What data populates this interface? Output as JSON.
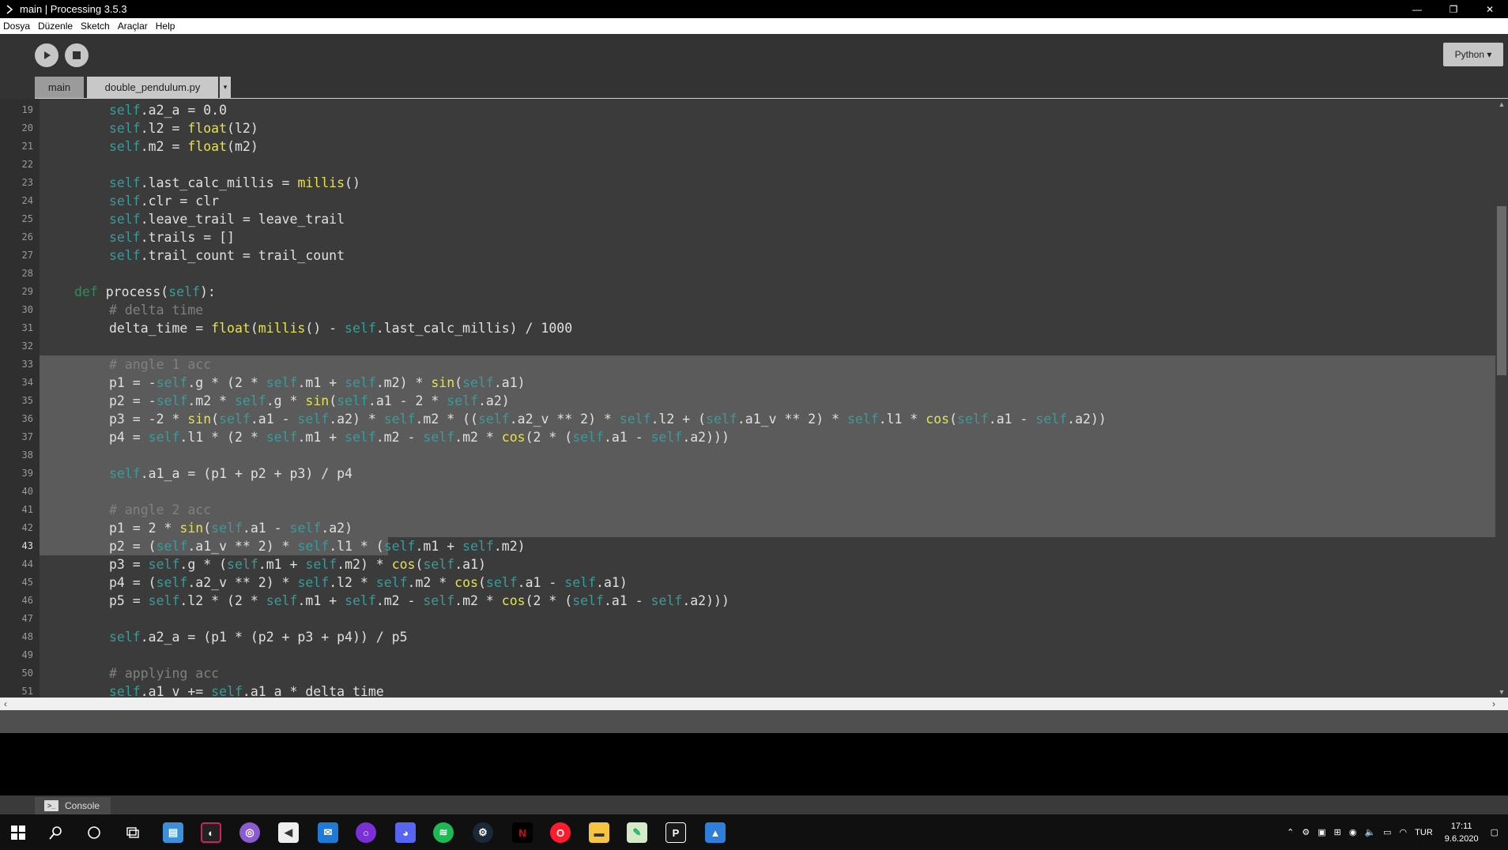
{
  "window": {
    "title": "main | Processing 3.5.3",
    "minimize": "—",
    "maximize": "❐",
    "close": "✕"
  },
  "menu": [
    "Dosya",
    "Düzenle",
    "Sketch",
    "Araçlar",
    "Help"
  ],
  "toolbar": {
    "run_icon": "play-icon",
    "stop_icon": "stop-icon",
    "mode": "Python ▾"
  },
  "tabs": [
    {
      "label": "main"
    },
    {
      "label": "double_pendulum.py"
    },
    {
      "label": "▾"
    }
  ],
  "editor": {
    "selection_start_line": 33,
    "selection_end_line": 43,
    "current_line": 43,
    "lines": [
      {
        "n": "19",
        "tokens": [
          [
            "s",
            "self"
          ],
          [
            "p",
            ".a2_a = 0.0"
          ]
        ]
      },
      {
        "n": "20",
        "tokens": [
          [
            "s",
            "self"
          ],
          [
            "p",
            ".l2 = "
          ],
          [
            "f",
            "float"
          ],
          [
            "p",
            "(l2)"
          ]
        ]
      },
      {
        "n": "21",
        "tokens": [
          [
            "s",
            "self"
          ],
          [
            "p",
            ".m2 = "
          ],
          [
            "f",
            "float"
          ],
          [
            "p",
            "(m2)"
          ]
        ]
      },
      {
        "n": "22",
        "tokens": []
      },
      {
        "n": "23",
        "tokens": [
          [
            "s",
            "self"
          ],
          [
            "p",
            ".last_calc_millis = "
          ],
          [
            "f",
            "millis"
          ],
          [
            "p",
            "()"
          ]
        ]
      },
      {
        "n": "24",
        "tokens": [
          [
            "s",
            "self"
          ],
          [
            "p",
            ".clr = clr"
          ]
        ]
      },
      {
        "n": "25",
        "tokens": [
          [
            "s",
            "self"
          ],
          [
            "p",
            ".leave_trail = leave_trail"
          ]
        ]
      },
      {
        "n": "26",
        "tokens": [
          [
            "s",
            "self"
          ],
          [
            "p",
            ".trails = []"
          ]
        ]
      },
      {
        "n": "27",
        "tokens": [
          [
            "s",
            "self"
          ],
          [
            "p",
            ".trail_count = trail_count"
          ]
        ]
      },
      {
        "n": "28",
        "tokens": []
      },
      {
        "n": "29",
        "indent": 1,
        "tokens": [
          [
            "k",
            "def"
          ],
          [
            "p",
            " process("
          ],
          [
            "s",
            "self"
          ],
          [
            "p",
            "):"
          ]
        ]
      },
      {
        "n": "30",
        "tokens": [
          [
            "c",
            "# delta time"
          ]
        ]
      },
      {
        "n": "31",
        "tokens": [
          [
            "p",
            "delta_time = "
          ],
          [
            "f",
            "float"
          ],
          [
            "p",
            "("
          ],
          [
            "f",
            "millis"
          ],
          [
            "p",
            "() - "
          ],
          [
            "s",
            "self"
          ],
          [
            "p",
            ".last_calc_millis) / 1000"
          ]
        ]
      },
      {
        "n": "32",
        "tokens": []
      },
      {
        "n": "33",
        "tokens": [
          [
            "c",
            "# angle 1 acc"
          ]
        ]
      },
      {
        "n": "34",
        "tokens": [
          [
            "p",
            "p1 = -"
          ],
          [
            "s",
            "self"
          ],
          [
            "p",
            ".g * (2 * "
          ],
          [
            "s",
            "self"
          ],
          [
            "p",
            ".m1 + "
          ],
          [
            "s",
            "self"
          ],
          [
            "p",
            ".m2) * "
          ],
          [
            "f",
            "sin"
          ],
          [
            "p",
            "("
          ],
          [
            "s",
            "self"
          ],
          [
            "p",
            ".a1)"
          ]
        ]
      },
      {
        "n": "35",
        "tokens": [
          [
            "p",
            "p2 = -"
          ],
          [
            "s",
            "self"
          ],
          [
            "p",
            ".m2 * "
          ],
          [
            "s",
            "self"
          ],
          [
            "p",
            ".g * "
          ],
          [
            "f",
            "sin"
          ],
          [
            "p",
            "("
          ],
          [
            "s",
            "self"
          ],
          [
            "p",
            ".a1 - 2 * "
          ],
          [
            "s",
            "self"
          ],
          [
            "p",
            ".a2)"
          ]
        ]
      },
      {
        "n": "36",
        "tokens": [
          [
            "p",
            "p3 = -2 * "
          ],
          [
            "f",
            "sin"
          ],
          [
            "p",
            "("
          ],
          [
            "s",
            "self"
          ],
          [
            "p",
            ".a1 - "
          ],
          [
            "s",
            "self"
          ],
          [
            "p",
            ".a2) * "
          ],
          [
            "s",
            "self"
          ],
          [
            "p",
            ".m2 * (("
          ],
          [
            "s",
            "self"
          ],
          [
            "p",
            ".a2_v ** 2) * "
          ],
          [
            "s",
            "self"
          ],
          [
            "p",
            ".l2 + ("
          ],
          [
            "s",
            "self"
          ],
          [
            "p",
            ".a1_v ** 2) * "
          ],
          [
            "s",
            "self"
          ],
          [
            "p",
            ".l1 * "
          ],
          [
            "f",
            "cos"
          ],
          [
            "p",
            "("
          ],
          [
            "s",
            "self"
          ],
          [
            "p",
            ".a1 - "
          ],
          [
            "s",
            "self"
          ],
          [
            "p",
            ".a2))"
          ]
        ]
      },
      {
        "n": "37",
        "tokens": [
          [
            "p",
            "p4 = "
          ],
          [
            "s",
            "self"
          ],
          [
            "p",
            ".l1 * (2 * "
          ],
          [
            "s",
            "self"
          ],
          [
            "p",
            ".m1 + "
          ],
          [
            "s",
            "self"
          ],
          [
            "p",
            ".m2 - "
          ],
          [
            "s",
            "self"
          ],
          [
            "p",
            ".m2 * "
          ],
          [
            "f",
            "cos"
          ],
          [
            "p",
            "(2 * ("
          ],
          [
            "s",
            "self"
          ],
          [
            "p",
            ".a1 - "
          ],
          [
            "s",
            "self"
          ],
          [
            "p",
            ".a2)))"
          ]
        ]
      },
      {
        "n": "38",
        "tokens": []
      },
      {
        "n": "39",
        "tokens": [
          [
            "s",
            "self"
          ],
          [
            "p",
            ".a1_a = (p1 + p2 + p3) / p4"
          ]
        ]
      },
      {
        "n": "40",
        "tokens": []
      },
      {
        "n": "41",
        "tokens": [
          [
            "c",
            "# angle 2 acc"
          ]
        ]
      },
      {
        "n": "42",
        "tokens": [
          [
            "p",
            "p1 = 2 * "
          ],
          [
            "f",
            "sin"
          ],
          [
            "p",
            "("
          ],
          [
            "s",
            "self"
          ],
          [
            "p",
            ".a1 - "
          ],
          [
            "s",
            "self"
          ],
          [
            "p",
            ".a2)"
          ]
        ]
      },
      {
        "n": "43",
        "tokens": [
          [
            "p",
            "p2 = ("
          ],
          [
            "s",
            "self"
          ],
          [
            "p",
            ".a1_v ** 2) * "
          ],
          [
            "s",
            "self"
          ],
          [
            "p",
            ".l1 * ("
          ],
          [
            "s",
            "self"
          ],
          [
            "p",
            ".m1 + "
          ],
          [
            "s",
            "self"
          ],
          [
            "p",
            ".m2)"
          ]
        ]
      },
      {
        "n": "44",
        "tokens": [
          [
            "p",
            "p3 = "
          ],
          [
            "s",
            "self"
          ],
          [
            "p",
            ".g * ("
          ],
          [
            "s",
            "self"
          ],
          [
            "p",
            ".m1 + "
          ],
          [
            "s",
            "self"
          ],
          [
            "p",
            ".m2) * "
          ],
          [
            "f",
            "cos"
          ],
          [
            "p",
            "("
          ],
          [
            "s",
            "self"
          ],
          [
            "p",
            ".a1)"
          ]
        ]
      },
      {
        "n": "45",
        "tokens": [
          [
            "p",
            "p4 = ("
          ],
          [
            "s",
            "self"
          ],
          [
            "p",
            ".a2_v ** 2) * "
          ],
          [
            "s",
            "self"
          ],
          [
            "p",
            ".l2 * "
          ],
          [
            "s",
            "self"
          ],
          [
            "p",
            ".m2 * "
          ],
          [
            "f",
            "cos"
          ],
          [
            "p",
            "("
          ],
          [
            "s",
            "self"
          ],
          [
            "p",
            ".a1 - "
          ],
          [
            "s",
            "self"
          ],
          [
            "p",
            ".a1)"
          ]
        ]
      },
      {
        "n": "46",
        "tokens": [
          [
            "p",
            "p5 = "
          ],
          [
            "s",
            "self"
          ],
          [
            "p",
            ".l2 * (2 * "
          ],
          [
            "s",
            "self"
          ],
          [
            "p",
            ".m1 + "
          ],
          [
            "s",
            "self"
          ],
          [
            "p",
            ".m2 - "
          ],
          [
            "s",
            "self"
          ],
          [
            "p",
            ".m2 * "
          ],
          [
            "f",
            "cos"
          ],
          [
            "p",
            "(2 * ("
          ],
          [
            "s",
            "self"
          ],
          [
            "p",
            ".a1 - "
          ],
          [
            "s",
            "self"
          ],
          [
            "p",
            ".a2)))"
          ]
        ]
      },
      {
        "n": "47",
        "tokens": []
      },
      {
        "n": "48",
        "tokens": [
          [
            "s",
            "self"
          ],
          [
            "p",
            ".a2_a = (p1 * (p2 + p3 + p4)) / p5"
          ]
        ]
      },
      {
        "n": "49",
        "tokens": []
      },
      {
        "n": "50",
        "tokens": [
          [
            "c",
            "# applying acc"
          ]
        ]
      },
      {
        "n": "51",
        "tokens": [
          [
            "s",
            "self"
          ],
          [
            "p",
            ".a1_v += "
          ],
          [
            "s",
            "self"
          ],
          [
            "p",
            ".a1_a * delta_time"
          ]
        ]
      }
    ]
  },
  "console": {
    "tab_label": "Console"
  },
  "taskbar": {
    "apps": [
      "windows-start-icon",
      "search-icon",
      "cortana-icon",
      "task-view-icon",
      "explorer-app-icon",
      "app-icon",
      "app-icon",
      "vscode-icon",
      "mail-icon",
      "app-icon",
      "discord-icon",
      "spotify-icon",
      "steam-icon",
      "netflix-icon",
      "opera-icon",
      "file-explorer-icon",
      "notepad-icon",
      "processing-icon",
      "photos-icon"
    ],
    "lang": "TUR",
    "time": "17:11",
    "date": "9.6.2020"
  },
  "colors": {
    "self": "#3a9b9b",
    "function": "#e7e24a",
    "keyword": "#2e8b57",
    "comment": "#808080",
    "selection": "#5b5b5b"
  }
}
